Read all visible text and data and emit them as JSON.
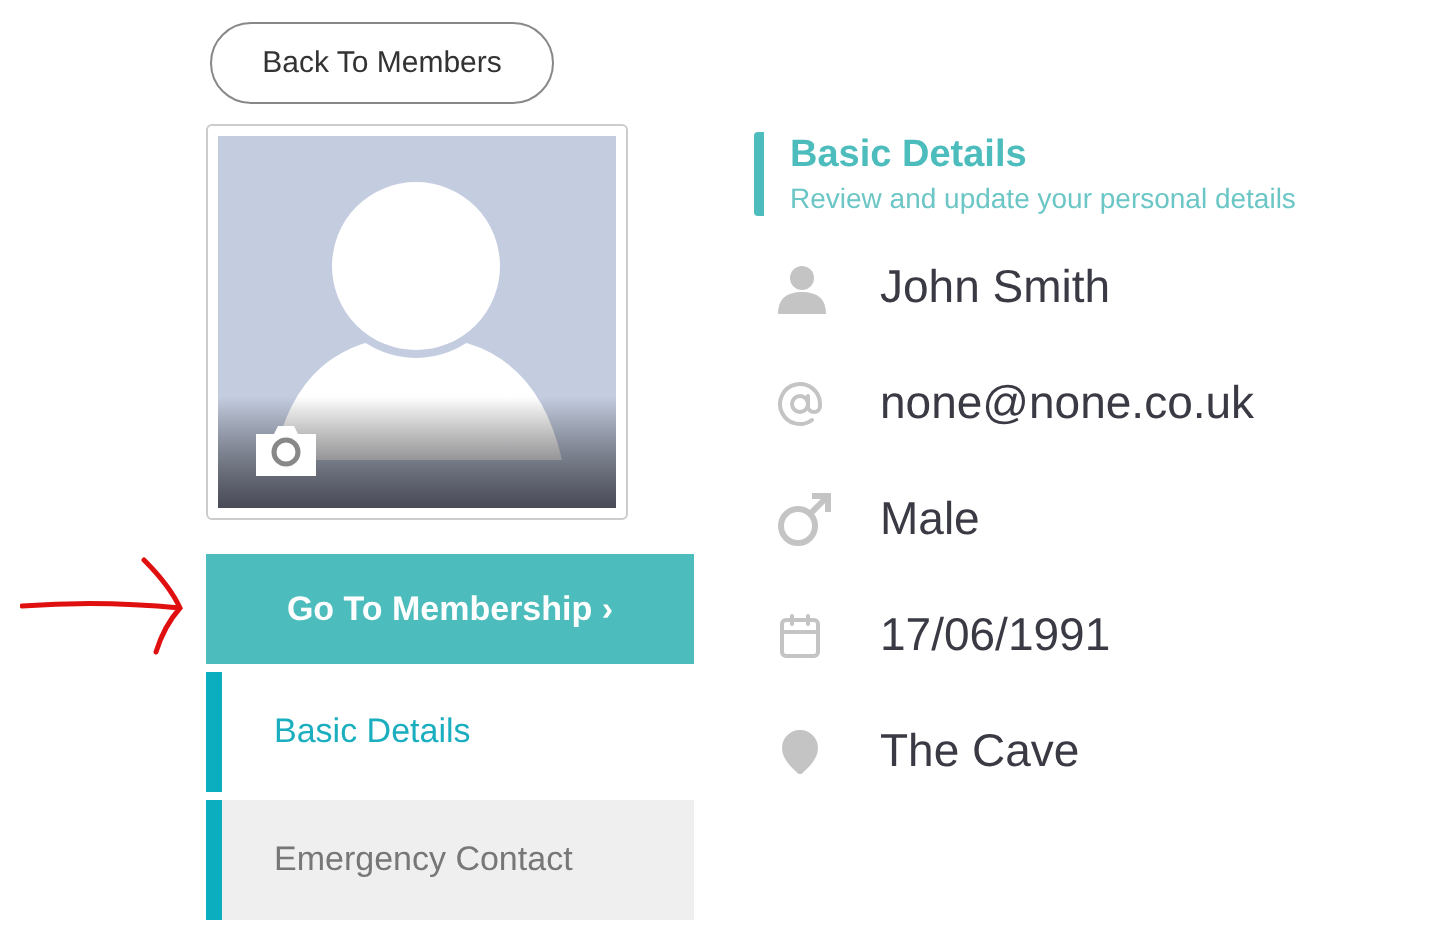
{
  "back_button": {
    "label": "Back To Members"
  },
  "profile_photo": {
    "kind": "placeholder"
  },
  "membership_button": {
    "label": "Go To Membership",
    "chevron": "›"
  },
  "nav_items": [
    {
      "label": "Basic Details",
      "selected": true
    },
    {
      "label": "Emergency Contact",
      "selected": false
    }
  ],
  "section": {
    "title": "Basic Details",
    "subtitle": "Review and update your personal details"
  },
  "details": [
    {
      "kind": "person",
      "value": "John Smith"
    },
    {
      "kind": "email",
      "value": "none@none.co.uk"
    },
    {
      "kind": "gender",
      "value": "Male"
    },
    {
      "kind": "date",
      "value": "17/06/1991"
    },
    {
      "kind": "location",
      "value": "The Cave"
    }
  ]
}
